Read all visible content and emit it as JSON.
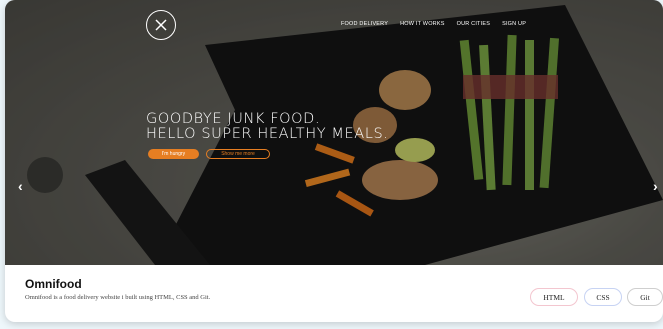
{
  "nav": {
    "items": [
      "FOOD DELIVERY",
      "HOW IT WORKS",
      "OUR CITIES",
      "SIGN UP"
    ]
  },
  "hero": {
    "headline_line1": "GOODBYE JUNK FOOD.",
    "headline_line2": "HELLO SUPER HEALTHY MEALS.",
    "primary_button": "I'm hungry",
    "secondary_button": "Show me more",
    "prev_arrow": "‹",
    "next_arrow": "›"
  },
  "project": {
    "title": "Omnifood",
    "description": "Omnifood is a food delivery website i built using HTML, CSS and Git.",
    "tags": [
      "HTML",
      "CSS",
      "Git"
    ]
  },
  "colors": {
    "accent": "#e67e22"
  },
  "icons": [
    "logo-icon",
    "chevron-left-icon",
    "chevron-right-icon"
  ]
}
